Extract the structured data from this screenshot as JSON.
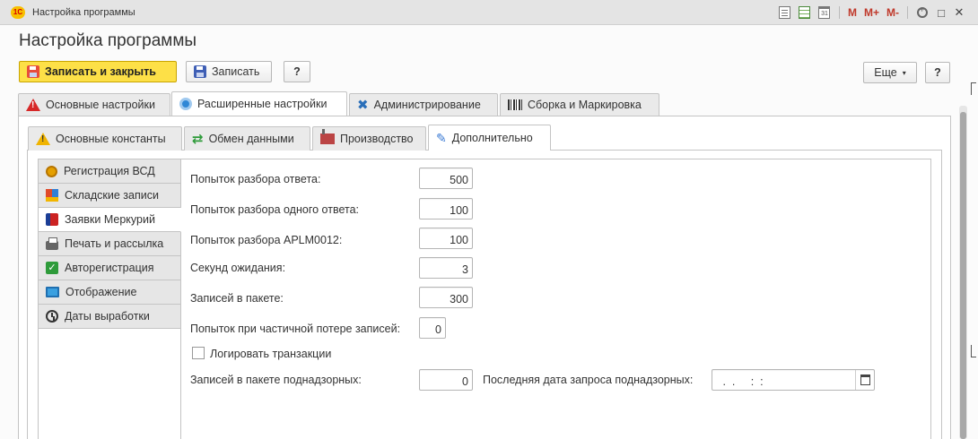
{
  "window": {
    "title": "Настройка программы",
    "logo": "1С",
    "toolbar_icons": [
      "document-icon",
      "table-icon",
      "calendar-icon"
    ],
    "memory_buttons": [
      "M",
      "M+",
      "M-"
    ],
    "calendar_number": "31"
  },
  "page": {
    "title": "Настройка программы"
  },
  "toolbar": {
    "save_close": "Записать и закрыть",
    "save": "Записать",
    "help": "?",
    "more": "Еще",
    "help_right": "?"
  },
  "tabs": [
    {
      "label": "Основные настройки",
      "icon": "warning-icon"
    },
    {
      "label": "Расширенные настройки",
      "icon": "settings-icon",
      "active": true
    },
    {
      "label": "Администрирование",
      "icon": "tools-icon"
    },
    {
      "label": "Сборка и Маркировка",
      "icon": "barcode-icon"
    }
  ],
  "subtabs": [
    {
      "label": "Основные константы",
      "icon": "warning-icon"
    },
    {
      "label": "Обмен данными",
      "icon": "sync-icon"
    },
    {
      "label": "Производство",
      "icon": "factory-icon"
    },
    {
      "label": "Дополнительно",
      "icon": "pen-icon",
      "active": true
    }
  ],
  "side_tabs": [
    {
      "label": "Регистрация ВСД",
      "icon": "medal-icon"
    },
    {
      "label": "Складские записи",
      "icon": "boxes-icon"
    },
    {
      "label": "Заявки Меркурий",
      "icon": "cube-icon",
      "active": true
    },
    {
      "label": "Печать и рассылка",
      "icon": "printer-icon"
    },
    {
      "label": "Авторегистрация",
      "icon": "check-icon"
    },
    {
      "label": "Отображение",
      "icon": "monitor-icon"
    },
    {
      "label": "Даты выработки",
      "icon": "clock-icon"
    }
  ],
  "form": {
    "fields": [
      {
        "label": "Попыток разбора ответа:",
        "value": "500"
      },
      {
        "label": "Попыток разбора одного ответа:",
        "value": "100"
      },
      {
        "label": "Попыток разбора APLM0012:",
        "value": "100"
      },
      {
        "label": "Секунд ожидания:",
        "value": "3"
      },
      {
        "label": "Записей в пакете:",
        "value": "300"
      },
      {
        "label": "Попыток при частичной потере записей:",
        "value": "0"
      }
    ],
    "checkbox_label": "Логировать транзакции",
    "checkbox_checked": false,
    "supervised_label": "Записей в пакете поднадзорных:",
    "supervised_value": "0",
    "last_date_label": "Последняя дата запроса поднадзорных:",
    "last_date_value": " .  .     :  :"
  }
}
